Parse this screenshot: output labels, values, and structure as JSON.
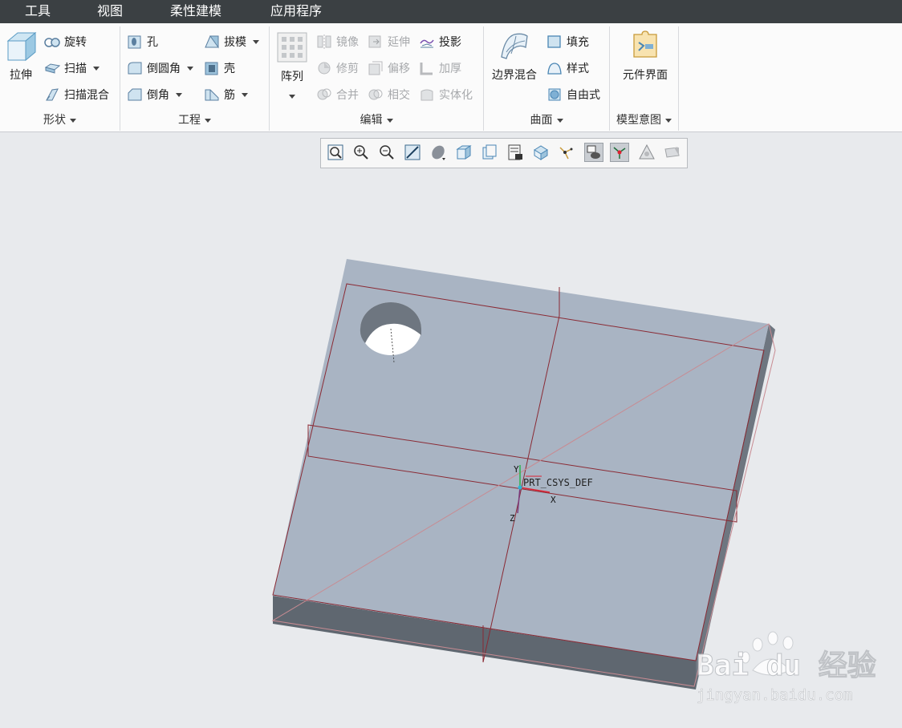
{
  "menubar": {
    "items": [
      "工具",
      "视图",
      "柔性建模",
      "应用程序"
    ]
  },
  "ribbon": {
    "shape": {
      "label": "形状",
      "extrude": "拉伸",
      "revolve": "旋转",
      "sweep": "扫描",
      "swept_blend": "扫描混合"
    },
    "engineering": {
      "label": "工程",
      "hole": "孔",
      "draft": "拔模",
      "round": "倒圆角",
      "shell": "壳",
      "chamfer": "倒角",
      "rib": "筋"
    },
    "editing": {
      "label": "编辑",
      "pattern": "阵列",
      "mirror": "镜像",
      "extend": "延伸",
      "project": "投影",
      "trim": "修剪",
      "offset": "偏移",
      "thicken": "加厚",
      "merge": "合并",
      "intersect": "相交",
      "solidify": "实体化"
    },
    "surfaces": {
      "label": "曲面",
      "boundary_blend": "边界混合",
      "fill": "填充",
      "style": "样式",
      "freestyle": "自由式"
    },
    "model_intent": {
      "label": "模型意图",
      "component_interface": "元件界面"
    }
  },
  "viewport": {
    "csys_label": "PRT_CSYS_DEF",
    "axis_x": "X",
    "axis_y": "Y",
    "axis_z": "Z"
  },
  "watermark": {
    "brand": "Bai du 经验",
    "url": "jingyan.baidu.com"
  },
  "colors": {
    "menubar_bg": "#3b4043",
    "top_face": "#a9b4c3",
    "side_face": "#5f6770",
    "datum_line": "#8a2a34",
    "viewport_bg": "#e8eaed"
  }
}
